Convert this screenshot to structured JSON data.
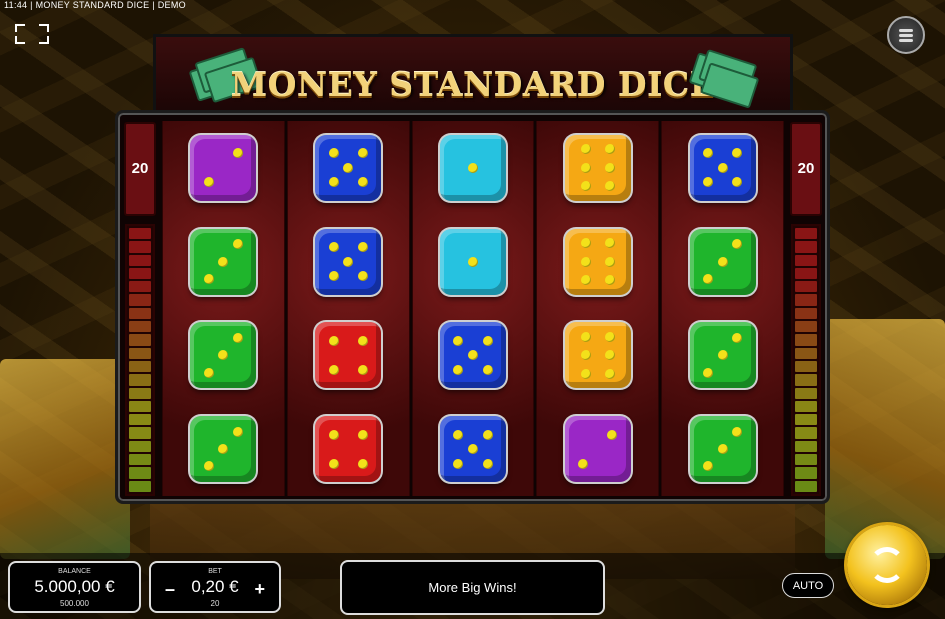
{
  "window": {
    "title": "11:44 | MONEY STANDARD DICE | DEMO"
  },
  "logo": {
    "text": "MONEY STANDARD DICE"
  },
  "side": {
    "left_counter": "20",
    "right_counter": "20"
  },
  "colors": {
    "purple": "#9a27c6",
    "blue": "#1a3fd4",
    "cyan": "#26c2e0",
    "orange": "#f5a814",
    "green": "#1fb52c",
    "red": "#d91a1a",
    "pip": "#f3e11a"
  },
  "reels": [
    [
      {
        "color": "purple",
        "pips": 2
      },
      {
        "color": "green",
        "pips": 3
      },
      {
        "color": "green",
        "pips": 3
      },
      {
        "color": "green",
        "pips": 3
      }
    ],
    [
      {
        "color": "blue",
        "pips": 5
      },
      {
        "color": "blue",
        "pips": 5
      },
      {
        "color": "red",
        "pips": 4
      },
      {
        "color": "red",
        "pips": 4
      }
    ],
    [
      {
        "color": "cyan",
        "pips": 1
      },
      {
        "color": "cyan",
        "pips": 1
      },
      {
        "color": "blue",
        "pips": 5
      },
      {
        "color": "blue",
        "pips": 5
      }
    ],
    [
      {
        "color": "orange",
        "pips": 6
      },
      {
        "color": "orange",
        "pips": 6
      },
      {
        "color": "orange",
        "pips": 6
      },
      {
        "color": "purple",
        "pips": 2
      }
    ],
    [
      {
        "color": "blue",
        "pips": 5
      },
      {
        "color": "green",
        "pips": 3
      },
      {
        "color": "green",
        "pips": 3
      },
      {
        "color": "green",
        "pips": 3
      }
    ]
  ],
  "balance": {
    "label": "BALANCE",
    "value": "5.000,00 €",
    "sub": "500.000"
  },
  "bet": {
    "label": "BET",
    "value": "0,20 €",
    "sub": "20",
    "minus": "–",
    "plus": "+"
  },
  "message": "More Big Wins!",
  "auto_label": "AUTO",
  "icons": {
    "menu": "hamburger-icon",
    "fullscreen": "fullscreen-icon",
    "spin": "spin-arrows-icon"
  }
}
